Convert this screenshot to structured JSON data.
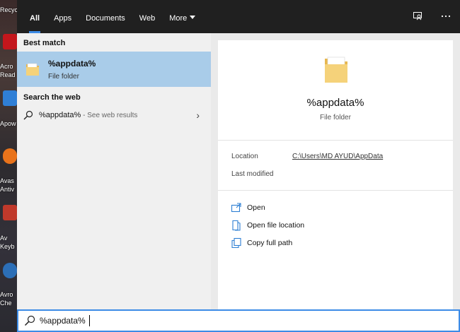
{
  "desktop": {
    "icons": [
      {
        "label": "Recyc",
        "name": "recycle-bin-desktop-icon",
        "color": "#7c7c7c"
      },
      {
        "label": "Acro",
        "label2": "Read",
        "name": "acrobat-reader-desktop-icon",
        "color": "#c4161c"
      },
      {
        "label": "Apow",
        "name": "apowersoft-desktop-icon",
        "color": "#2f7fd6"
      },
      {
        "label": "Avas",
        "label2": "Antiv",
        "name": "avast-antivirus-desktop-icon",
        "color": "#e9731b"
      },
      {
        "label": "Av",
        "label2": "Keyb",
        "name": "avro-keyboard-desktop-icon",
        "color": "#c0392b"
      },
      {
        "label": "Avro",
        "label2": "Che",
        "name": "avro-checker-desktop-icon",
        "color": "#2c6fb7"
      }
    ]
  },
  "tabs": [
    {
      "label": "All",
      "active": true
    },
    {
      "label": "Apps",
      "active": false
    },
    {
      "label": "Documents",
      "active": false
    },
    {
      "label": "Web",
      "active": false
    },
    {
      "label": "More",
      "active": false
    }
  ],
  "top_icons": [
    "feedback-icon",
    "more-options-icon"
  ],
  "left": {
    "best_match_header": "Best match",
    "best_match": {
      "title": "%appdata%",
      "subtitle": "File folder",
      "icon": "folder-icon"
    },
    "web_header": "Search the web",
    "web_result": {
      "query": "%appdata%",
      "suffix": " - See web results",
      "icon": "search-icon"
    }
  },
  "preview": {
    "title": "%appdata%",
    "subtitle": "File folder",
    "location_label": "Location",
    "location_value": "C:\\Users\\MD AYUD\\AppData",
    "modified_label": "Last modified",
    "actions": [
      {
        "label": "Open",
        "icon": "open-icon"
      },
      {
        "label": "Open file location",
        "icon": "file-location-icon"
      },
      {
        "label": "Copy full path",
        "icon": "copy-icon"
      }
    ]
  },
  "search": {
    "value": "%appdata%"
  },
  "colors": {
    "accent": "#3c8be6",
    "selected": "#a9cce9",
    "topbar": "#202020",
    "folder": "#f5d27a"
  }
}
